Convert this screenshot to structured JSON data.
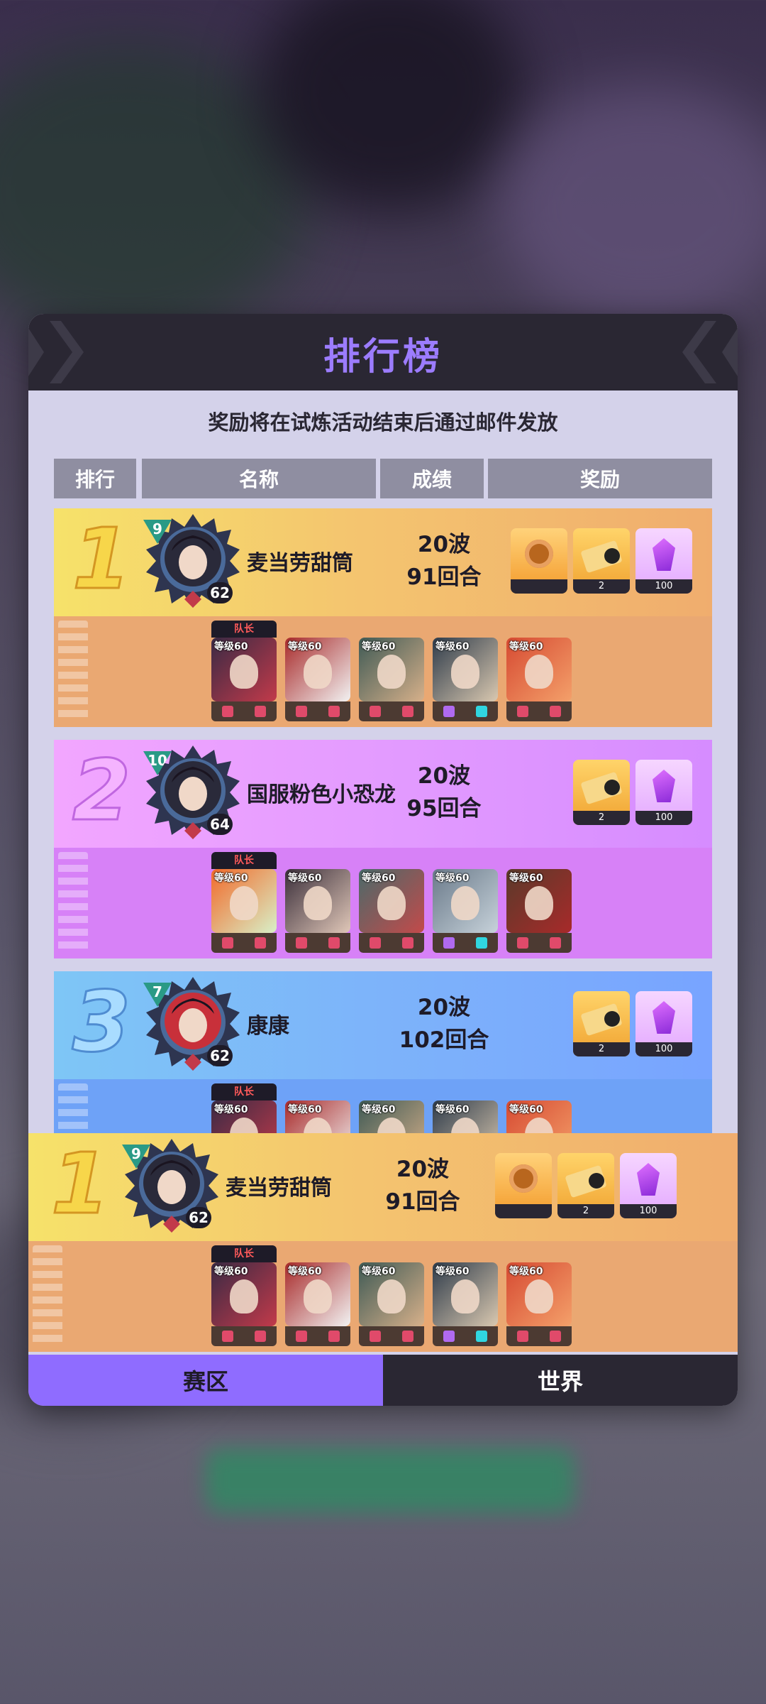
{
  "leaderboard": {
    "title": "排行榜",
    "notice": "奖励将在试炼活动结束后通过邮件发放",
    "columns": [
      "排行",
      "名称",
      "成绩",
      "奖励"
    ],
    "entries": [
      {
        "rank": "1",
        "level": "9",
        "avatar_level": "62",
        "name": "麦当劳甜筒",
        "waves": "20波",
        "rounds": "91回合",
        "rewards": [
          {
            "icon": "monkey-chest-icon",
            "count": ""
          },
          {
            "icon": "golden-ticket-icon",
            "count": "2"
          },
          {
            "icon": "purple-crystal-icon",
            "count": "100"
          }
        ],
        "captain_label": "队长",
        "heroes": [
          "等级60",
          "等级60",
          "等级60",
          "等级60",
          "等级60"
        ]
      },
      {
        "rank": "2",
        "level": "10",
        "avatar_level": "64",
        "name": "国服粉色小恐龙",
        "waves": "20波",
        "rounds": "95回合",
        "rewards": [
          {
            "icon": "golden-ticket-icon",
            "count": "2"
          },
          {
            "icon": "purple-crystal-icon",
            "count": "100"
          }
        ],
        "captain_label": "队长",
        "heroes": [
          "等级60",
          "等级60",
          "等级60",
          "等级60",
          "等级60"
        ]
      },
      {
        "rank": "3",
        "level": "7",
        "avatar_level": "62",
        "name": "康康",
        "waves": "20波",
        "rounds": "102回合",
        "rewards": [
          {
            "icon": "golden-ticket-icon",
            "count": "2"
          },
          {
            "icon": "purple-crystal-icon",
            "count": "100"
          }
        ],
        "captain_label": "队长",
        "heroes": [
          "等级60",
          "等级60",
          "等级60",
          "等级60",
          "等级60"
        ]
      }
    ],
    "my_entry": {
      "rank": "1",
      "level": "9",
      "avatar_level": "62",
      "name": "麦当劳甜筒",
      "waves": "20波",
      "rounds": "91回合",
      "rewards": [
        {
          "icon": "monkey-chest-icon",
          "count": ""
        },
        {
          "icon": "golden-ticket-icon",
          "count": "2"
        },
        {
          "icon": "purple-crystal-icon",
          "count": "100"
        }
      ],
      "captain_label": "队长",
      "heroes": [
        "等级60",
        "等级60",
        "等级60",
        "等级60",
        "等级60"
      ]
    },
    "tabs": [
      {
        "label": "赛区",
        "active": true
      },
      {
        "label": "世界",
        "active": false
      }
    ],
    "colors": {
      "accent": "#9c7cff",
      "header_bg": "#2a2733",
      "rank1": "#f0ad6e",
      "rank2": "#d98aff",
      "rank3": "#7fb5ff"
    }
  }
}
